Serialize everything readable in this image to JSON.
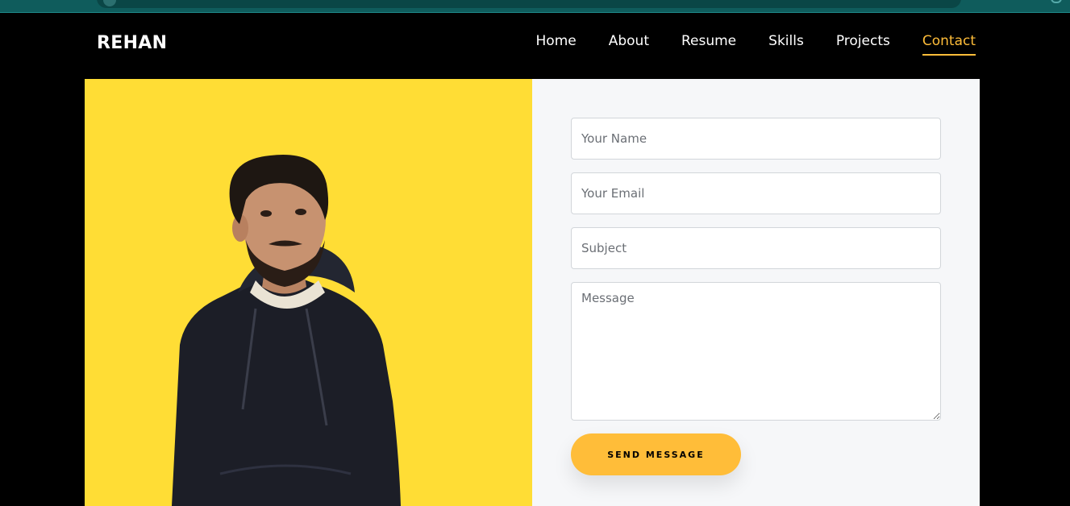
{
  "brand": {
    "logo": "REHAN"
  },
  "nav": {
    "items": [
      {
        "label": "Home"
      },
      {
        "label": "About"
      },
      {
        "label": "Resume"
      },
      {
        "label": "Skills"
      },
      {
        "label": "Projects"
      },
      {
        "label": "Contact",
        "active": true
      }
    ]
  },
  "colors": {
    "accent": "#ffbd39",
    "photo_bg": "#ffdd35",
    "form_bg": "#f6f7f9",
    "page_bg": "#000000"
  },
  "contact_form": {
    "name_placeholder": "Your Name",
    "email_placeholder": "Your Email",
    "subject_placeholder": "Subject",
    "message_placeholder": "Message",
    "submit_label": "SEND MESSAGE"
  },
  "photo": {
    "icon": "portrait-photo"
  }
}
